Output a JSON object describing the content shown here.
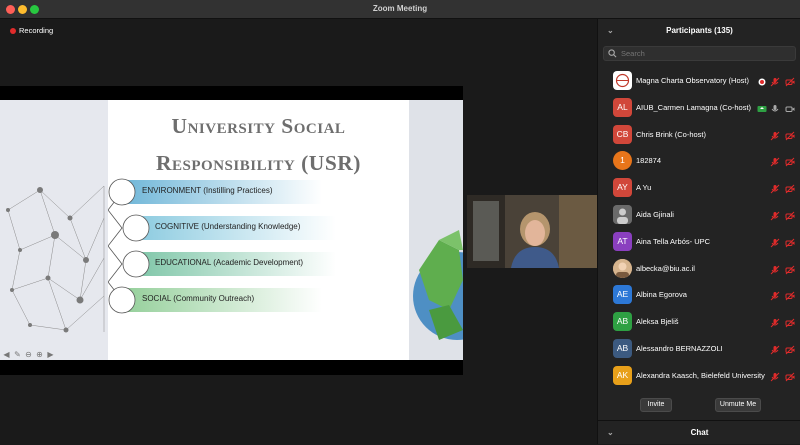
{
  "window": {
    "title": "Zoom Meeting"
  },
  "recording": {
    "label": "Recording"
  },
  "slide": {
    "title_line1": "University Social",
    "title_line2": "Responsibility (USR)",
    "items": [
      "ENVIRONMENT (Instilling Practices)",
      "COGNITIVE (Understanding Knowledge)",
      "EDUCATIONAL (Academic Development)",
      "SOCIAL (Community Outreach)"
    ]
  },
  "participants": {
    "header": "Participants (135)",
    "search_placeholder": "Search",
    "list": [
      {
        "name": "Magna Charta Observatory (Host)",
        "initials": "",
        "color": "#ffffff",
        "mic": "muted",
        "video": "off",
        "recording": true
      },
      {
        "name": "AIUB_Carmen Lamagna (Co-host)",
        "initials": "AL",
        "color": "#d1473a",
        "mic": "on",
        "video": "on",
        "recording": false,
        "badge": true
      },
      {
        "name": "Chris Brink (Co-host)",
        "initials": "CB",
        "color": "#d1473a",
        "mic": "muted",
        "video": "off",
        "recording": false
      },
      {
        "name": "182874",
        "initials": "1",
        "color": "#e8751a",
        "mic": "muted",
        "video": "off",
        "recording": false
      },
      {
        "name": "A Yu",
        "initials": "AY",
        "color": "#d1473a",
        "mic": "muted",
        "video": "off",
        "recording": false
      },
      {
        "name": "Aida Gjinali",
        "initials": "",
        "color": "#555555",
        "mic": "muted",
        "video": "off",
        "recording": false
      },
      {
        "name": "Aina Tella Arbós- UPC",
        "initials": "AT",
        "color": "#8a3fbf",
        "mic": "muted",
        "video": "off",
        "recording": false
      },
      {
        "name": "albecka@biu.ac.il",
        "initials": "",
        "color": "#c9a27a",
        "mic": "muted",
        "video": "off",
        "recording": false
      },
      {
        "name": "Albina Egorova",
        "initials": "AE",
        "color": "#2d78d6",
        "mic": "muted",
        "video": "off",
        "recording": false
      },
      {
        "name": "Aleksa Bjeliš",
        "initials": "AB",
        "color": "#2ea043",
        "mic": "muted",
        "video": "off",
        "recording": false
      },
      {
        "name": "Alessandro BERNAZZOLI",
        "initials": "AB",
        "color": "#3c5a80",
        "mic": "muted",
        "video": "off",
        "recording": false
      },
      {
        "name": "Alexandra Kaasch, Bielefeld University",
        "initials": "AK",
        "color": "#e8a01a",
        "mic": "muted",
        "video": "off",
        "recording": false
      }
    ],
    "invite_label": "Invite",
    "unmute_label": "Unmute Me"
  },
  "chat": {
    "header": "Chat"
  },
  "colors": {
    "recording_dot": "#e02b2b",
    "muted_red": "#e02b2b",
    "panel_bg": "#232323"
  }
}
